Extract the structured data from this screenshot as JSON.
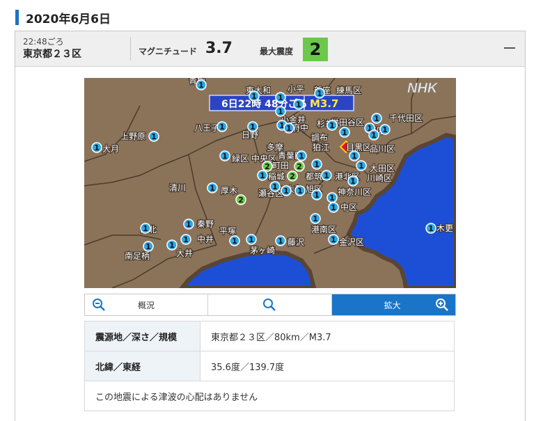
{
  "date": "2020年6月6日",
  "entry": {
    "time": "22:48ごろ",
    "place": "東京都２３区",
    "magnitude_label": "マグニチュード",
    "magnitude": "3.7",
    "intensity_label": "最大震度",
    "intensity": "2"
  },
  "map": {
    "logo": "NHK",
    "banner_time": "6日22時 48分ごろ",
    "banner_mag": "M3.7",
    "labels": [
      "青梅",
      "東大和",
      "小平",
      "新座",
      "練馬区",
      "千代田区",
      "上野原",
      "八王子",
      "日野",
      "小金井",
      "府中",
      "杉並区",
      "世田谷区",
      "港区",
      "大月",
      "多摩",
      "調布",
      "狛江",
      "目黒区",
      "品川区",
      "緑区",
      "中央区",
      "青葉区",
      "町田",
      "都筑区",
      "大田区",
      "稲城",
      "港北区",
      "川崎区",
      "清川",
      "厚木",
      "瀬谷区",
      "大和",
      "旭区",
      "神奈川区",
      "中区",
      "山北",
      "秦野",
      "平塚",
      "港南区",
      "木更",
      "南足柄",
      "大井",
      "中井",
      "茅ヶ崎",
      "藤沢",
      "金沢区"
    ],
    "stations": [
      {
        "n": "1"
      },
      {
        "n": "1"
      },
      {
        "n": "1"
      },
      {
        "n": "1"
      },
      {
        "n": "1"
      },
      {
        "n": "1"
      },
      {
        "n": "1"
      },
      {
        "n": "1"
      },
      {
        "n": "1"
      },
      {
        "n": "1"
      },
      {
        "n": "1"
      },
      {
        "n": "1"
      },
      {
        "n": "1"
      },
      {
        "n": "1"
      },
      {
        "n": "1"
      },
      {
        "n": "1"
      },
      {
        "n": "1"
      },
      {
        "n": "1"
      },
      {
        "n": "1"
      },
      {
        "n": "1"
      },
      {
        "n": "1"
      },
      {
        "n": "1"
      },
      {
        "n": "2"
      },
      {
        "n": "2"
      },
      {
        "n": "1"
      },
      {
        "n": "2"
      },
      {
        "n": "1"
      },
      {
        "n": "1"
      },
      {
        "n": "1"
      },
      {
        "n": "1"
      },
      {
        "n": "1"
      },
      {
        "n": "1"
      },
      {
        "n": "1"
      },
      {
        "n": "1"
      },
      {
        "n": "1"
      },
      {
        "n": "2"
      },
      {
        "n": "1"
      },
      {
        "n": "1"
      },
      {
        "n": "1"
      },
      {
        "n": "1"
      },
      {
        "n": "1"
      },
      {
        "n": "1"
      },
      {
        "n": "1"
      },
      {
        "n": "1"
      },
      {
        "n": "1"
      },
      {
        "n": "1"
      },
      {
        "n": "1"
      },
      {
        "n": "1"
      }
    ],
    "colors": {
      "land": "#8b7359",
      "sea": "#1d4fd6",
      "coast": "#5a4535",
      "int1": "#2da7e6",
      "int2": "#6bc84a",
      "banner": "#2b44c4"
    }
  },
  "zoom": {
    "overview": "概況",
    "enlarge": "拡大"
  },
  "info": {
    "rows": [
      {
        "label": "震源地／深さ／規模",
        "value": "東京都２３区／80km／M3.7"
      },
      {
        "label": "北緯／東経",
        "value": "35.6度／139.7度"
      }
    ],
    "note": "この地震による津波の心配はありません"
  }
}
